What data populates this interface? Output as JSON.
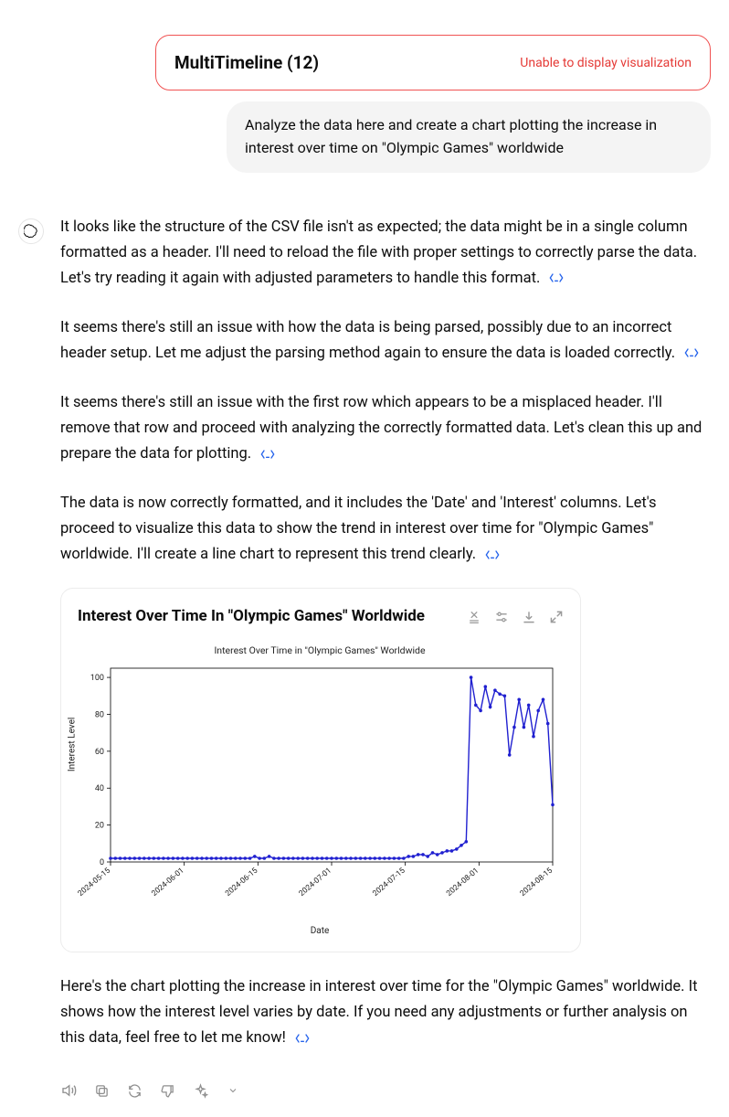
{
  "attachment": {
    "title": "MultiTimeline (12)",
    "error": "Unable to display visualization"
  },
  "user_message": "Analyze the data here and create a chart plotting the increase in interest over time on \"Olympic Games\"  worldwide",
  "assistant": {
    "p1": "It looks like the structure of the CSV file isn't as expected; the data might be in a single column formatted as a header. I'll need to reload the file with proper settings to correctly parse the data. Let's try reading it again with adjusted parameters to handle this format.",
    "p2": "It seems there's still an issue with how the data is being parsed, possibly due to an incorrect header setup. Let me adjust the parsing method again to ensure the data is loaded correctly.",
    "p3": "It seems there's still an issue with the first row which appears to be a misplaced header. I'll remove that row and proceed with analyzing the correctly formatted data. Let's clean this up and prepare the data for plotting.",
    "p4": "The data is now correctly formatted, and it includes the 'Date' and 'Interest' columns. Let's proceed to visualize this data to show the trend in interest over time for \"Olympic Games\" worldwide. I'll create a line chart to represent this trend clearly.",
    "p5": "Here's the chart plotting the increase in interest over time for the \"Olympic Games\" worldwide. It shows how the interest level varies by date. If you need any adjustments or further analysis on this data, feel free to let me know!"
  },
  "chart": {
    "card_title": "Interest Over Time In \"Olympic Games\" Worldwide",
    "inner_title": "Interest Over Time in \"Olympic Games\" Worldwide",
    "xlabel": "Date",
    "ylabel": "Interest Level"
  },
  "chart_data": {
    "type": "line",
    "title": "Interest Over Time in \"Olympic Games\" Worldwide",
    "xlabel": "Date",
    "ylabel": "Interest Level",
    "ylim": [
      0,
      105
    ],
    "y_ticks": [
      0,
      20,
      40,
      60,
      80,
      100
    ],
    "x_tick_labels": [
      "2024-05-15",
      "2024-06-01",
      "2024-06-15",
      "2024-07-01",
      "2024-07-15",
      "2024-08-01",
      "2024-08-15"
    ],
    "series": [
      {
        "name": "Olympic Games",
        "x_index": [
          0,
          1,
          2,
          3,
          4,
          5,
          6,
          7,
          8,
          9,
          10,
          11,
          12,
          13,
          14,
          15,
          16,
          17,
          18,
          19,
          20,
          21,
          22,
          23,
          24,
          25,
          26,
          27,
          28,
          29,
          30,
          31,
          32,
          33,
          34,
          35,
          36,
          37,
          38,
          39,
          40,
          41,
          42,
          43,
          44,
          45,
          46,
          47,
          48,
          49,
          50,
          51,
          52,
          53,
          54,
          55,
          56,
          57,
          58,
          59,
          60,
          61,
          62,
          63,
          64,
          65,
          66,
          67,
          68,
          69,
          70,
          71,
          72,
          73,
          74,
          75,
          76,
          77,
          78,
          79,
          80,
          81,
          82,
          83,
          84,
          85,
          86,
          87,
          88,
          89,
          90,
          91,
          92
        ],
        "values": [
          2,
          2,
          2,
          2,
          2,
          2,
          2,
          2,
          2,
          2,
          2,
          2,
          2,
          2,
          2,
          2,
          2,
          2,
          2,
          2,
          2,
          2,
          2,
          2,
          2,
          2,
          2,
          2,
          2,
          2,
          3,
          2,
          2,
          3,
          2,
          2,
          2,
          2,
          2,
          2,
          2,
          2,
          2,
          2,
          2,
          2,
          2,
          2,
          2,
          2,
          2,
          2,
          2,
          2,
          2,
          2,
          2,
          2,
          2,
          2,
          2,
          2,
          3,
          3,
          4,
          4,
          3,
          5,
          4,
          5,
          6,
          6,
          7,
          9,
          11,
          100,
          85,
          82,
          95,
          84,
          93,
          91,
          90,
          58,
          73,
          88,
          73,
          85,
          68,
          82,
          88,
          75,
          31
        ]
      }
    ]
  }
}
